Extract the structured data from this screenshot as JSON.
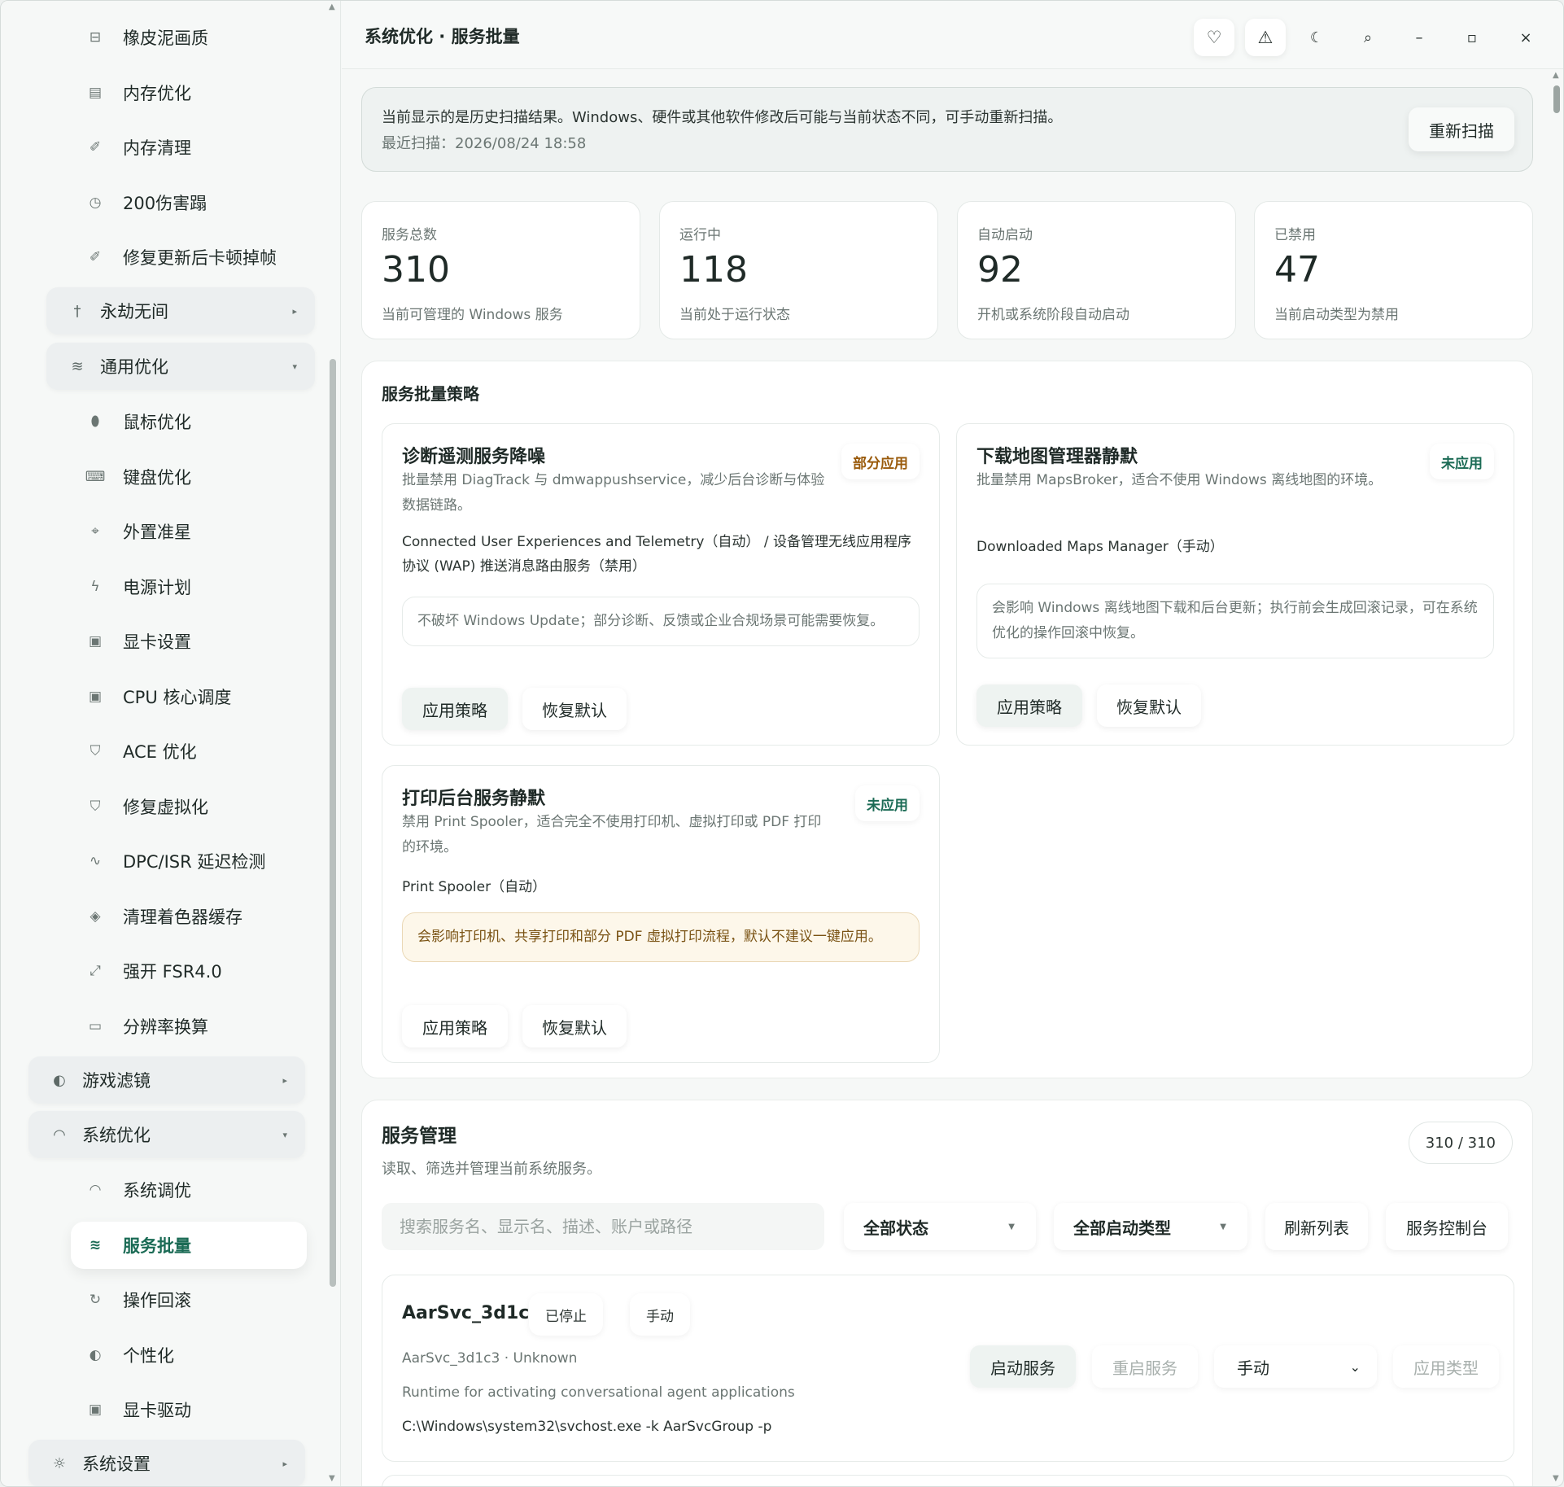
{
  "sidebar": {
    "items_top": [
      {
        "label": "橡皮泥画质",
        "icon": "sliders-icon",
        "glyph": "⊟"
      },
      {
        "label": "内存优化",
        "icon": "memory-icon",
        "glyph": "▤"
      },
      {
        "label": "内存清理",
        "icon": "broom-icon",
        "glyph": "✐"
      },
      {
        "label": "200伤害蹋",
        "icon": "timer-icon",
        "glyph": "◷"
      },
      {
        "label": "修复更新后卡顿掉帧",
        "icon": "broom-icon",
        "glyph": "✐"
      }
    ],
    "group_eternal": {
      "label": "永劫无间",
      "icon": "sword-icon",
      "glyph": "†",
      "arrow": "▸"
    },
    "group_general": {
      "label": "通用优化",
      "icon": "tune-icon",
      "glyph": "≋",
      "arrow": "▾"
    },
    "items_general": [
      {
        "label": "鼠标优化",
        "icon": "mouse-icon",
        "glyph": "⬮"
      },
      {
        "label": "键盘优化",
        "icon": "keyboard-icon",
        "glyph": "⌨"
      },
      {
        "label": "外置准星",
        "icon": "crosshair-icon",
        "glyph": "⌖"
      },
      {
        "label": "电源计划",
        "icon": "bolt-icon",
        "glyph": "ϟ"
      },
      {
        "label": "显卡设置",
        "icon": "chip-icon",
        "glyph": "▣"
      },
      {
        "label": "CPU 核心调度",
        "icon": "cpu-icon",
        "glyph": "▣"
      },
      {
        "label": "ACE 优化",
        "icon": "shield-icon",
        "glyph": "⛉"
      },
      {
        "label": "修复虚拟化",
        "icon": "shield-icon",
        "glyph": "⛉"
      },
      {
        "label": "DPC/ISR 延迟检测",
        "icon": "pulse-icon",
        "glyph": "∿"
      },
      {
        "label": "清理着色器缓存",
        "icon": "layers-icon",
        "glyph": "◈"
      },
      {
        "label": "强开 FSR4.0",
        "icon": "expand-icon",
        "glyph": "⤢"
      },
      {
        "label": "分辨率换算",
        "icon": "monitor-icon",
        "glyph": "▭"
      }
    ],
    "group_filter": {
      "label": "游戏滤镜",
      "icon": "palette-icon",
      "glyph": "◐",
      "arrow": "▸"
    },
    "group_system": {
      "label": "系统优化",
      "icon": "gauge-icon",
      "glyph": "◠",
      "arrow": "▾"
    },
    "items_system": [
      {
        "label": "系统调优",
        "icon": "gauge-icon",
        "glyph": "◠"
      },
      {
        "label": "服务批量",
        "icon": "tune-icon",
        "glyph": "≋",
        "active": true
      },
      {
        "label": "操作回滚",
        "icon": "rollback-icon",
        "glyph": "↻"
      },
      {
        "label": "个性化",
        "icon": "palette-icon",
        "glyph": "◐"
      },
      {
        "label": "显卡驱动",
        "icon": "chip-icon",
        "glyph": "▣"
      }
    ],
    "group_settings": {
      "label": "系统设置",
      "icon": "gear-icon",
      "glyph": "☼",
      "arrow": "▸"
    }
  },
  "header": {
    "title": "系统优化 · 服务批量",
    "buttons": {
      "favorite": "♡",
      "warning": "⚠",
      "theme": "☾",
      "search": "⌕",
      "minimize": "–",
      "maximize": "▫",
      "close": "×"
    }
  },
  "notice": {
    "text": "当前显示的是历史扫描结果。Windows、硬件或其他软件修改后可能与当前状态不同，可手动重新扫描。",
    "last_scan": "最近扫描：2026/08/24 18:58",
    "rescan_label": "重新扫描"
  },
  "stats": [
    {
      "label": "服务总数",
      "value": "310",
      "desc": "当前可管理的 Windows 服务"
    },
    {
      "label": "运行中",
      "value": "118",
      "desc": "当前处于运行状态"
    },
    {
      "label": "自动启动",
      "value": "92",
      "desc": "开机或系统阶段自动启动"
    },
    {
      "label": "已禁用",
      "value": "47",
      "desc": "当前启动类型为禁用"
    }
  ],
  "policies": {
    "title": "服务批量策略",
    "cards": [
      {
        "title": "诊断遥测服务降噪",
        "status": "部分应用",
        "status_color": "#9a5b0c",
        "desc": "批量禁用 DiagTrack 与 dmwappushservice，减少后台诊断与体验数据链路。",
        "services": "Connected User Experiences and Telemetry（自动） / 设备管理无线应用程序协议 (WAP) 推送消息路由服务（禁用）",
        "note": "不破坏 Windows Update；部分诊断、反馈或企业合规场景可能需要恢复。",
        "apply": "应用策略",
        "restore": "恢复默认"
      },
      {
        "title": "下载地图管理器静默",
        "status": "未应用",
        "status_color": "#1b6b55",
        "desc": "批量禁用 MapsBroker，适合不使用 Windows 离线地图的环境。",
        "services": "Downloaded Maps Manager（手动）",
        "note": "会影响 Windows 离线地图下载和后台更新；执行前会生成回滚记录，可在系统优化的操作回滚中恢复。",
        "apply": "应用策略",
        "restore": "恢复默认"
      },
      {
        "title": "打印后台服务静默",
        "status": "未应用",
        "status_color": "#1b6b55",
        "desc": "禁用 Print Spooler，适合完全不使用打印机、虚拟打印或 PDF 打印的环境。",
        "services": "Print Spooler（自动）",
        "note": "会影响打印机、共享打印和部分 PDF 虚拟打印流程，默认不建议一键应用。",
        "apply": "应用策略",
        "restore": "恢复默认"
      }
    ]
  },
  "service_mgmt": {
    "title": "服务管理",
    "subtitle": "读取、筛选并管理当前系统服务。",
    "count": "310 / 310",
    "search_placeholder": "搜索服务名、显示名、描述、账户或路径",
    "filter_status": "全部状态",
    "filter_start_type": "全部启动类型",
    "refresh_label": "刷新列表",
    "console_label": "服务控制台",
    "service": {
      "name": "AarSvc_3d1c3",
      "state": "已停止",
      "start_type": "手动",
      "meta": "AarSvc_3d1c3 · Unknown",
      "description": "Runtime for activating conversational agent applications",
      "path": "C:\\Windows\\system32\\svchost.exe -k AarSvcGroup -p",
      "start_btn": "启动服务",
      "restart_btn": "重启服务",
      "type_select": "手动",
      "apply_type_btn": "应用类型"
    }
  }
}
